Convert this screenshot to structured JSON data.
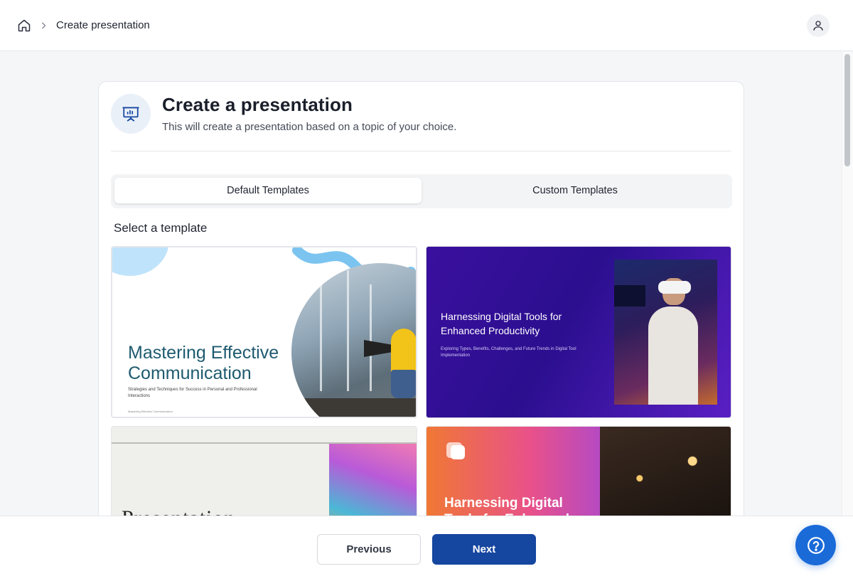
{
  "header": {
    "breadcrumb_current": "Create presentation",
    "icons": {
      "home": "home-icon",
      "separator": "chevron-right-icon",
      "user": "user-icon"
    }
  },
  "card": {
    "icon": "presentation-board-icon",
    "title": "Create a presentation",
    "subtitle": "This will create a presentation based on a topic of your choice.",
    "tabs": [
      {
        "label": "Default Templates",
        "active": true
      },
      {
        "label": "Custom Templates",
        "active": false
      }
    ],
    "select_label": "Select a template",
    "templates": [
      {
        "title": "Mastering Effective Communication",
        "subtitle": "Strategies and Techniques for Success in Personal and Professional Interactions",
        "footer": "Mastering Effective Communication"
      },
      {
        "title": "Harnessing Digital Tools for Enhanced Productivity",
        "subtitle": "Exploring Types, Benefits, Challenges, and Future Trends in Digital Tool Implementation"
      },
      {
        "title": "Presentation"
      },
      {
        "title": "Harnessing Digital Tools for Enhanced"
      }
    ]
  },
  "footer": {
    "previous_label": "Previous",
    "next_label": "Next",
    "help_icon": "help-icon"
  },
  "colors": {
    "primary": "#1546a0",
    "help_button": "#1a6ad8",
    "background": "#f5f6f8"
  }
}
